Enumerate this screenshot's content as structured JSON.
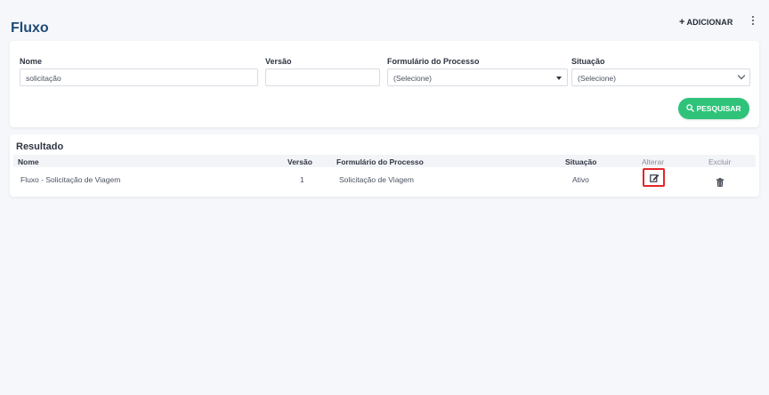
{
  "header": {
    "title": "Fluxo",
    "add_label": "ADICIONAR",
    "menu_icon": "kebab-menu-icon"
  },
  "filters": {
    "nome": {
      "label": "Nome",
      "value": "solicitação"
    },
    "versao": {
      "label": "Versão",
      "value": ""
    },
    "formulario": {
      "label": "Formulário do Processo",
      "selected": "(Selecione)"
    },
    "situacao": {
      "label": "Situação",
      "selected": "(Selecione)"
    },
    "search_label": "PESQUISAR"
  },
  "results": {
    "title": "Resultado",
    "columns": {
      "nome": "Nome",
      "versao": "Versão",
      "formulario": "Formulário do Processo",
      "situacao": "Situação",
      "alterar": "Alterar",
      "excluir": "Excluir"
    },
    "rows": [
      {
        "nome": "Fluxo - Solicitação de Viagem",
        "versao": "1",
        "formulario": "Solicitação de Viagem",
        "situacao": "Ativo"
      }
    ]
  },
  "colors": {
    "title": "#1e4a78",
    "accent": "#2fc37a",
    "highlight": "#e4262a"
  }
}
